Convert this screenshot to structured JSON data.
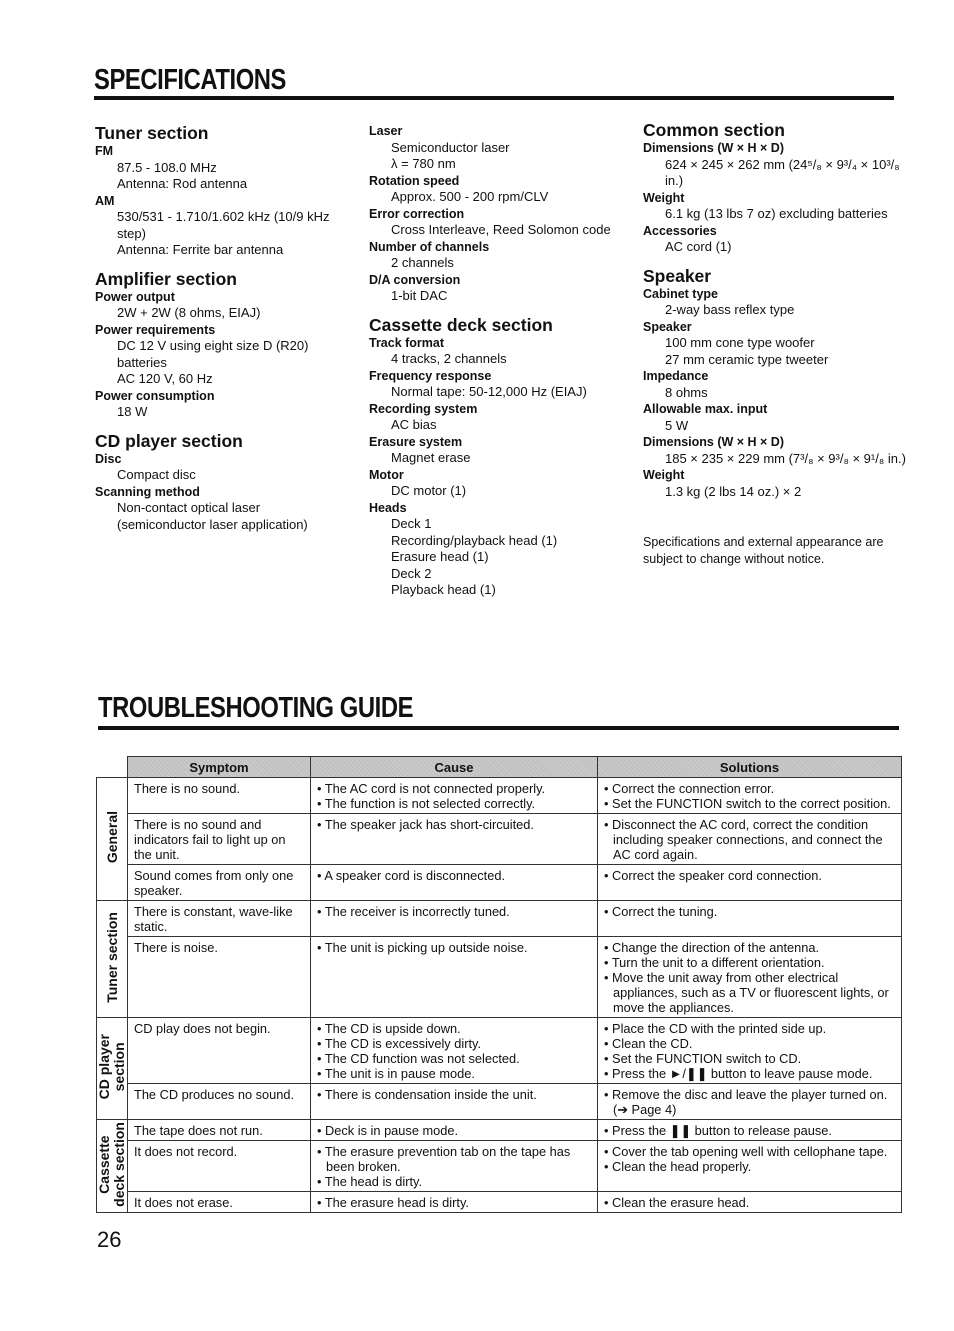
{
  "specifications": {
    "title": "SPECIFICATIONS",
    "tuner": {
      "title": "Tuner section",
      "items": [
        {
          "label": "FM",
          "values": [
            "87.5 - 108.0 MHz",
            "Antenna: Rod antenna"
          ]
        },
        {
          "label": "AM",
          "values": [
            "530/531 - 1.710/1.602 kHz (10/9 kHz step)",
            "Antenna: Ferrite bar antenna"
          ]
        }
      ]
    },
    "amplifier": {
      "title": "Amplifier section",
      "items": [
        {
          "label": "Power output",
          "values": [
            "2W + 2W (8 ohms, EIAJ)"
          ]
        },
        {
          "label": "Power requirements",
          "values": [
            "DC 12 V using eight size D (R20) batteries",
            "AC 120 V, 60 Hz"
          ]
        },
        {
          "label": "Power consumption",
          "values": [
            "18 W"
          ]
        }
      ]
    },
    "cd_player": {
      "title": "CD player section",
      "items": [
        {
          "label": "Disc",
          "values": [
            "Compact disc"
          ]
        },
        {
          "label": "Scanning method",
          "values": [
            "Non-contact optical laser",
            "(semiconductor laser application)"
          ]
        }
      ]
    },
    "cd_continued": {
      "items": [
        {
          "label": "Laser",
          "values": [
            "Semiconductor laser",
            "λ = 780 nm"
          ]
        },
        {
          "label": "Rotation speed",
          "values": [
            "Approx. 500 - 200 rpm/CLV"
          ]
        },
        {
          "label": "Error correction",
          "values": [
            "Cross Interleave, Reed Solomon code"
          ]
        },
        {
          "label": "Number of channels",
          "values": [
            "2 channels"
          ]
        },
        {
          "label": "D/A conversion",
          "values": [
            "1-bit DAC"
          ]
        }
      ]
    },
    "cassette": {
      "title": "Cassette deck section",
      "items": [
        {
          "label": "Track format",
          "values": [
            "4 tracks, 2 channels"
          ]
        },
        {
          "label": "Frequency response",
          "values": [
            "Normal tape: 50-12,000 Hz (EIAJ)"
          ]
        },
        {
          "label": "Recording system",
          "values": [
            "AC bias"
          ]
        },
        {
          "label": "Erasure system",
          "values": [
            "Magnet erase"
          ]
        },
        {
          "label": "Motor",
          "values": [
            "DC motor (1)"
          ]
        },
        {
          "label": "Heads",
          "values": [
            "Deck 1",
            "Recording/playback head (1)",
            "Erasure head (1)",
            "Deck 2",
            "Playback head (1)"
          ]
        }
      ]
    },
    "common": {
      "title": "Common section",
      "items": [
        {
          "label": "Dimensions (W × H × D)",
          "values": [
            "624 × 245 × 262 mm  (24⁵/₈ × 9³/₄ × 10³/₈ in.)"
          ]
        },
        {
          "label": "Weight",
          "values": [
            "6.1 kg (13 lbs 7 oz) excluding batteries"
          ]
        },
        {
          "label": "Accessories",
          "values": [
            "AC cord (1)"
          ]
        }
      ]
    },
    "speaker": {
      "title": "Speaker",
      "items": [
        {
          "label": "Cabinet type",
          "values": [
            "2-way bass reflex type"
          ]
        },
        {
          "label": "Speaker",
          "values": [
            "100 mm cone type woofer",
            "27 mm ceramic type tweeter"
          ]
        },
        {
          "label": "Impedance",
          "values": [
            "8 ohms"
          ]
        },
        {
          "label": "Allowable max. input",
          "values": [
            "5 W"
          ]
        },
        {
          "label": "Dimensions (W × H × D)",
          "values": [
            "185 × 235 × 229 mm (7³/₈ × 9³/₈ × 9¹/₈ in.)"
          ]
        },
        {
          "label": "Weight",
          "values": [
            "1.3 kg (2 lbs 14 oz.) × 2"
          ]
        }
      ]
    },
    "note": "Specifications and external appearance are subject to change without notice."
  },
  "troubleshooting": {
    "title": "TROUBLESHOOTING GUIDE",
    "headers": {
      "symptom": "Symptom",
      "cause": "Cause",
      "solutions": "Solutions"
    },
    "groups": [
      {
        "category": "General",
        "rows": [
          {
            "symptom": "There is no sound.",
            "causes": [
              "The AC cord is not connected properly.",
              "The function is not selected correctly."
            ],
            "solutions": [
              "Correct the connection error.",
              "Set the FUNCTION switch to the correct position."
            ]
          },
          {
            "symptom": "There is no sound and indicators fail to light up on the unit.",
            "causes": [
              "The speaker jack has short-circuited."
            ],
            "solutions": [
              "Disconnect the AC cord, correct the condition including speaker connections, and connect the AC cord again."
            ]
          },
          {
            "symptom": "Sound comes from only one speaker.",
            "causes": [
              " A speaker cord is disconnected."
            ],
            "solutions": [
              "Correct the speaker cord connection."
            ]
          }
        ]
      },
      {
        "category": "Tuner section",
        "rows": [
          {
            "symptom": "There is constant, wave-like static.",
            "causes": [
              " The receiver is incorrectly tuned."
            ],
            "solutions": [
              "Correct the tuning."
            ]
          },
          {
            "symptom": "There is noise.",
            "causes": [
              "The unit is picking up outside noise."
            ],
            "solutions": [
              "Change the direction of the antenna.",
              "Turn the unit to a different orientation.",
              "Move the unit away from other electrical appliances, such as a TV or fluorescent lights, or move the appliances."
            ]
          }
        ]
      },
      {
        "category": "CD player\nsection",
        "rows": [
          {
            "symptom": "CD play does not begin.",
            "causes": [
              "The CD is upside down.",
              "The CD is excessively dirty.",
              "The CD function was not selected.",
              "The unit is in pause mode."
            ],
            "solutions": [
              "Place the CD with the printed side up.",
              "Clean the CD.",
              "Set the FUNCTION switch to CD.",
              "Press the ►/❚❚ button to leave pause mode."
            ]
          },
          {
            "symptom": "The CD produces no sound.",
            "causes": [
              "There is condensation inside the unit."
            ],
            "solutions": [
              "Remove the disc and leave the player turned on. (➔ Page 4)"
            ]
          }
        ]
      },
      {
        "category": "Cassette\ndeck section",
        "rows": [
          {
            "symptom": "The tape does not run.",
            "causes": [
              "Deck is in pause mode."
            ],
            "solutions": [
              "Press the ❚❚ button to release pause."
            ]
          },
          {
            "symptom": "It does not record.",
            "causes": [
              "The erasure prevention tab on the tape has been broken.",
              "The head is dirty."
            ],
            "solutions": [
              "Cover the tab opening well with cellophane tape.",
              "Clean the head properly."
            ]
          },
          {
            "symptom": "It does not erase.",
            "causes": [
              "The erasure head is dirty."
            ],
            "solutions": [
              "Clean the erasure head."
            ]
          }
        ]
      }
    ]
  },
  "page_number": "26"
}
